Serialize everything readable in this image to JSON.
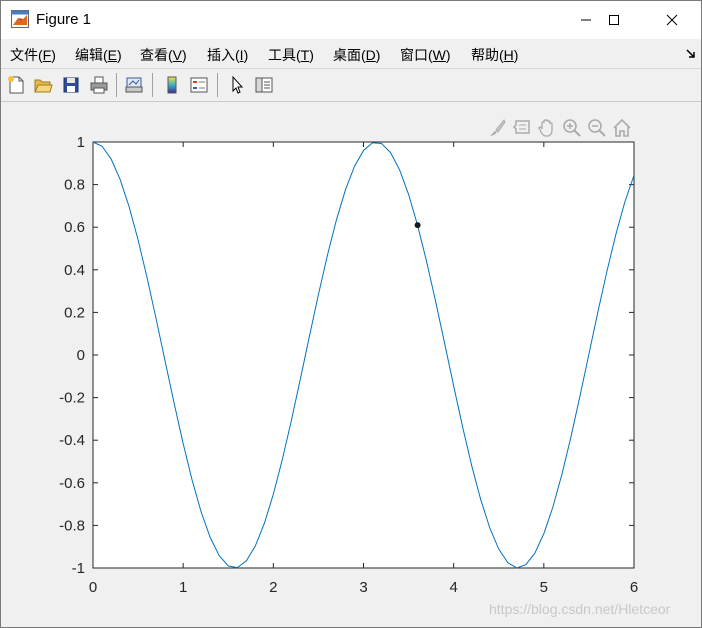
{
  "window": {
    "title": "Figure 1",
    "icon": "matlab-figure-icon"
  },
  "menu": [
    {
      "label": "文件(",
      "key": "F",
      "tail": ")"
    },
    {
      "label": "编辑(",
      "key": "E",
      "tail": ")"
    },
    {
      "label": "查看(",
      "key": "V",
      "tail": ")"
    },
    {
      "label": "插入(",
      "key": "I",
      "tail": ")"
    },
    {
      "label": "工具(",
      "key": "T",
      "tail": ")"
    },
    {
      "label": "桌面(",
      "key": "D",
      "tail": ")"
    },
    {
      "label": "窗口(",
      "key": "W",
      "tail": ")"
    },
    {
      "label": "帮助(",
      "key": "H",
      "tail": ")"
    }
  ],
  "toolbar": {
    "icons": [
      "new-figure-icon",
      "open-file-icon",
      "save-icon",
      "print-icon",
      "link-plot-icon",
      "insert-colorbar-icon",
      "insert-legend-icon",
      "edit-plot-icon",
      "property-inspector-icon"
    ]
  },
  "axes_toolbar": {
    "icons": [
      "brush-icon",
      "data-tips-icon",
      "pan-icon",
      "zoom-in-icon",
      "zoom-out-icon",
      "home-icon"
    ]
  },
  "chart_data": {
    "type": "line",
    "function": "cos(2x)",
    "xlim": [
      0,
      6
    ],
    "ylim": [
      -1,
      1
    ],
    "x_ticks": [
      "0",
      "1",
      "2",
      "3",
      "4",
      "5",
      "6"
    ],
    "y_ticks": [
      "-1",
      "-0.8",
      "-0.6",
      "-0.4",
      "-0.2",
      "0",
      "0.2",
      "0.4",
      "0.6",
      "0.8",
      "1"
    ],
    "x_step": 0.1,
    "line_color": "#0072bd",
    "marker": {
      "x": 3.6,
      "y": 0.61,
      "color": "#1a1a1a"
    },
    "grid": false,
    "box": true
  },
  "watermark": "https://blog.csdn.net/Hletceor"
}
